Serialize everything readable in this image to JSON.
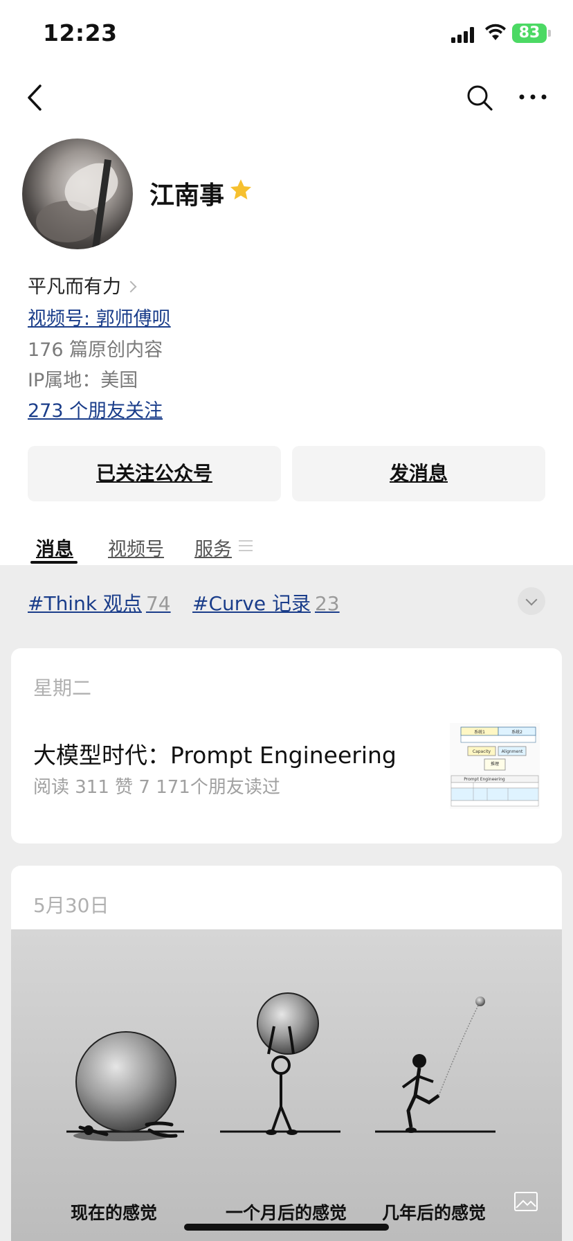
{
  "status_bar": {
    "time": "12:23",
    "battery": "83"
  },
  "profile": {
    "name": "江南事",
    "signature": "平凡而有力",
    "video_account": "视频号: 郭师傅呗",
    "original_count": "176 篇原创内容",
    "ip_location": "IP属地：美国",
    "friends_following": "273 个朋友关注"
  },
  "actions": {
    "following_label": "已关注公众号",
    "message_label": "发消息"
  },
  "tabs": [
    {
      "label": "消息",
      "active": true
    },
    {
      "label": "视频号",
      "active": false
    },
    {
      "label": "服务",
      "active": false
    }
  ],
  "tags": [
    {
      "label": "#Think 观点",
      "count": "74"
    },
    {
      "label": "#Curve 记录",
      "count": "23"
    }
  ],
  "feed": [
    {
      "day": "星期二",
      "title": "大模型时代：Prompt Engineering",
      "meta": "阅读 311  赞 7  171个朋友读过",
      "thumb_texts": [
        "系统1",
        "系统2",
        "Capacity",
        "Alignment",
        "推理",
        "Prompt Engineering"
      ]
    },
    {
      "day": "5月30日",
      "captions": [
        "现在的感觉",
        "一个月后的感觉",
        "几年后的感觉"
      ]
    }
  ],
  "colors": {
    "link": "#1a3d8a",
    "star": "#f6c02f",
    "battery": "#4cd964",
    "background_gray": "#ededed"
  }
}
